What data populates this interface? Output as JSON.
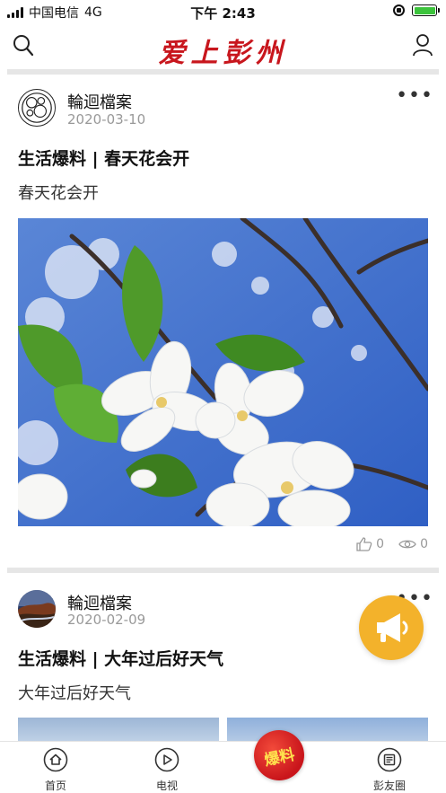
{
  "status_bar": {
    "carrier": "中国电信",
    "network": "4G",
    "time": "下午 2:43"
  },
  "header": {
    "logo_text": "爱上彭州",
    "brand_color": "#c8161d"
  },
  "posts": [
    {
      "author": "輪迴檔案",
      "date": "2020-03-10",
      "title": "生活爆料 | 春天花会开",
      "subtitle": "春天花会开",
      "likes": "0",
      "views": "0"
    },
    {
      "author": "輪迴檔案",
      "date": "2020-02-09",
      "title": "生活爆料 | 大年过后好天气",
      "subtitle": "大年过后好天气"
    }
  ],
  "fab": {
    "icon": "megaphone-icon",
    "color": "#f3b22b"
  },
  "tabbar": {
    "home_label": "首页",
    "tv_label": "电视",
    "center_label": "爆料",
    "circle_label": "彭友圈"
  },
  "icons": [
    "search-icon",
    "user-icon",
    "more-icon",
    "like-icon",
    "view-icon",
    "home-icon",
    "play-icon",
    "newspaper-icon",
    "megaphone-icon"
  ]
}
